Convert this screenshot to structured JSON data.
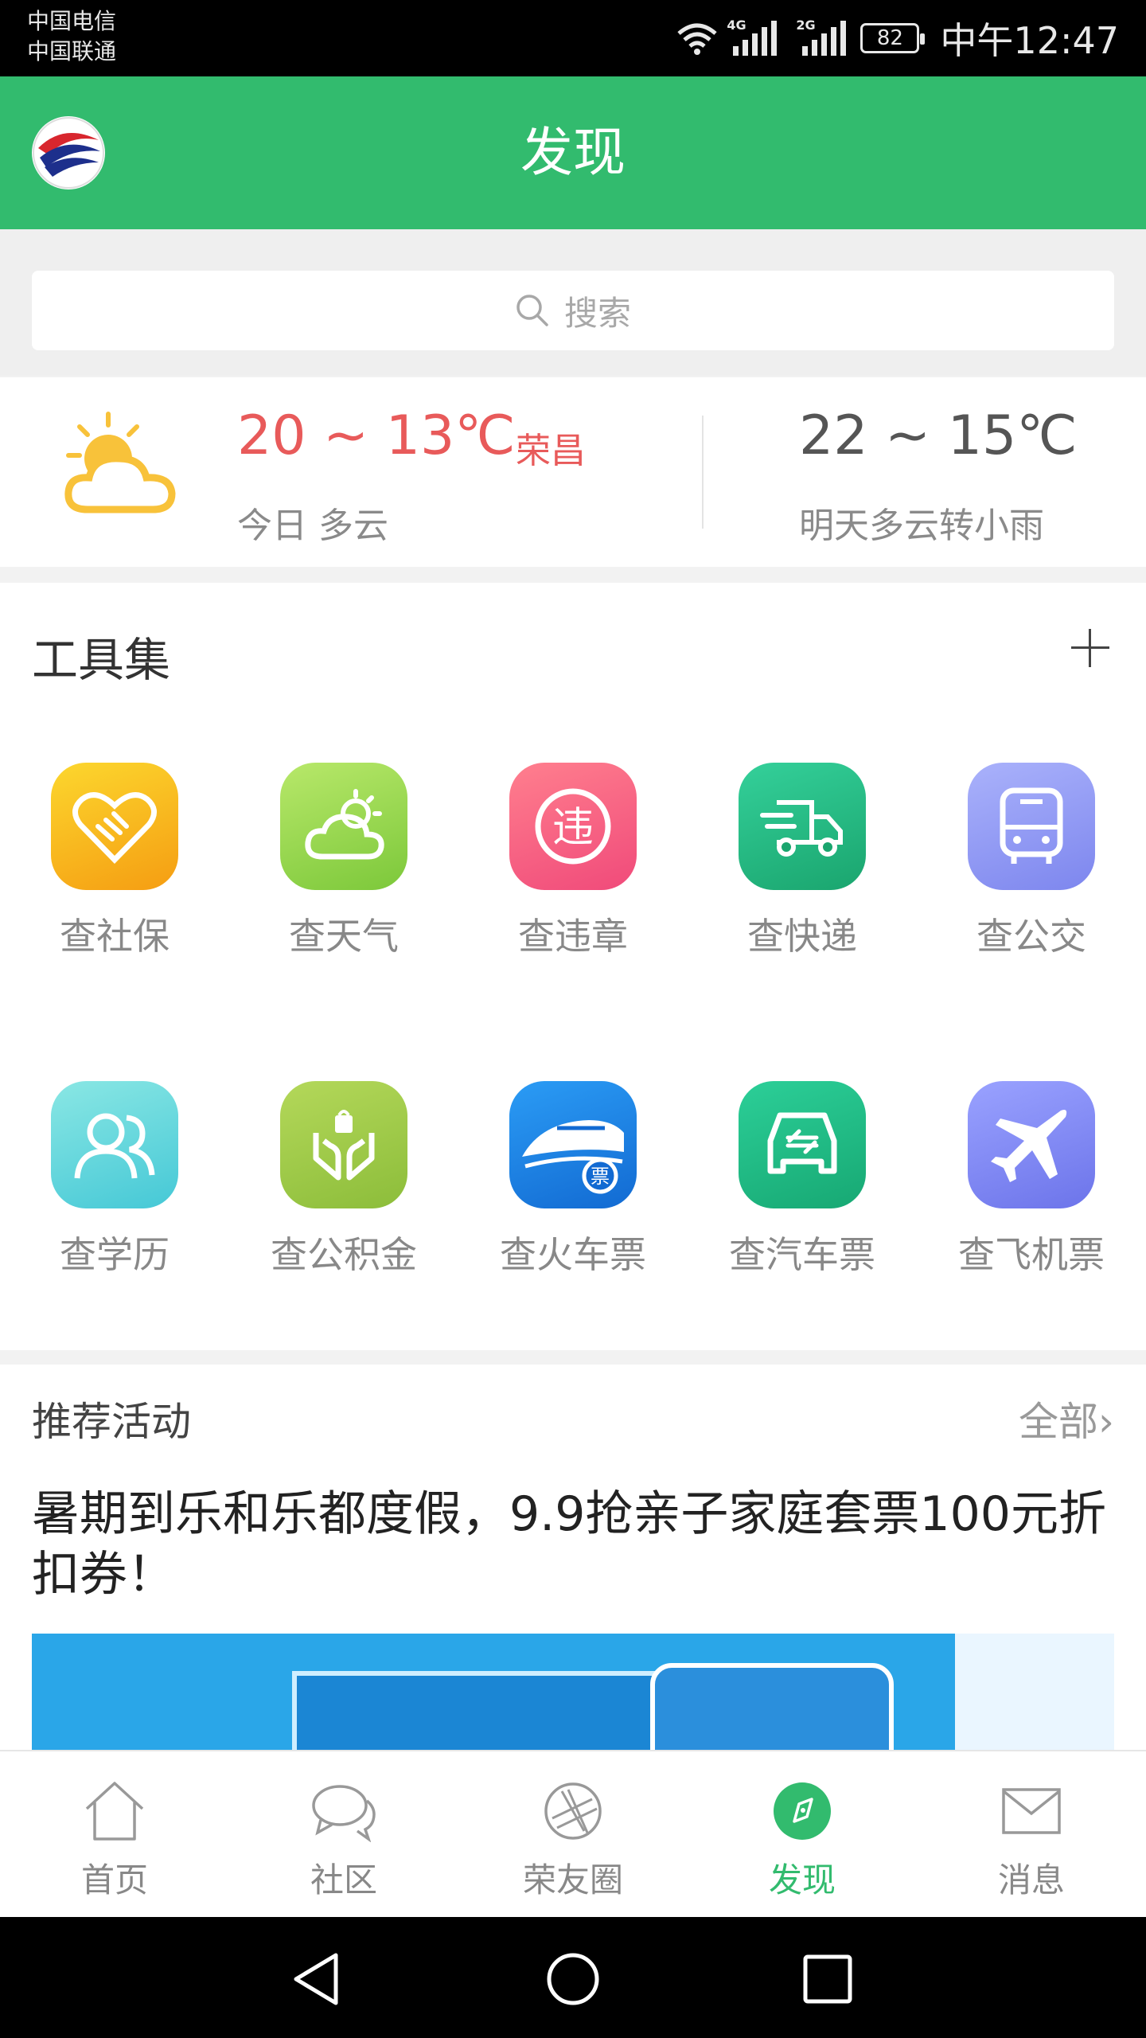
{
  "status_bar": {
    "carrier_1": "中国电信",
    "carrier_2": "中国联通",
    "network_1": "4G",
    "network_2": "2G",
    "battery": "82",
    "time": "中午12:47"
  },
  "header": {
    "title": "发现",
    "logo_icon": "app-logo-icon"
  },
  "search": {
    "placeholder": "搜索",
    "icon": "search-icon"
  },
  "weather": {
    "today_temp": "20 ~ 13℃",
    "city": "荣昌",
    "today_desc": "今日 多云",
    "tomorrow_temp": "22 ~ 15℃",
    "tomorrow_desc": "明天多云转小雨",
    "icon": "partly-cloudy-icon"
  },
  "tools": {
    "title": "工具集",
    "items": [
      {
        "label": "查社保",
        "icon": "handshake-heart-icon",
        "color": "#f8a91e"
      },
      {
        "label": "查天气",
        "icon": "weather-icon",
        "color": "#8ed24a"
      },
      {
        "label": "查违章",
        "icon": "violation-icon",
        "color": "#f35d7d"
      },
      {
        "label": "查快递",
        "icon": "delivery-truck-icon",
        "color": "#26b87f"
      },
      {
        "label": "查公交",
        "icon": "bus-icon",
        "color": "#8f98f5"
      },
      {
        "label": "查学历",
        "icon": "people-icon",
        "color": "#5fd6d8"
      },
      {
        "label": "查公积金",
        "icon": "hands-bag-icon",
        "color": "#9cc84a"
      },
      {
        "label": "查火车票",
        "icon": "train-ticket-icon",
        "color": "#1b7fe2"
      },
      {
        "label": "查汽车票",
        "icon": "car-ticket-icon",
        "color": "#1fb584"
      },
      {
        "label": "查飞机票",
        "icon": "airplane-icon",
        "color": "#7b84f5"
      }
    ]
  },
  "activities": {
    "title": "推荐活动",
    "all_label": "全部",
    "headline": "暑期到乐和乐都度假，9.9抢亲子家庭套票100元折扣券！"
  },
  "bottom_nav": {
    "items": [
      {
        "label": "首页",
        "icon": "home-icon"
      },
      {
        "label": "社区",
        "icon": "chat-bubble-icon"
      },
      {
        "label": "荣友圈",
        "icon": "aperture-icon"
      },
      {
        "label": "发现",
        "icon": "compass-icon"
      },
      {
        "label": "消息",
        "icon": "envelope-icon"
      }
    ],
    "active_index": 3,
    "active_color": "#32bb6e"
  },
  "colors": {
    "brand_green": "#32bb6e",
    "temp_red": "#e85a5a"
  }
}
